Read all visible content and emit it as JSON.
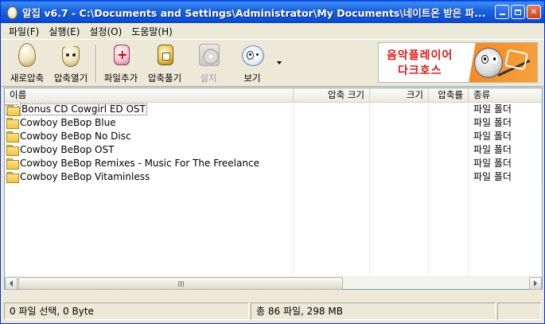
{
  "window": {
    "title": "알집 v6.7 - C:\\Documents and Settings\\Administrator\\My Documents\\네이트온 받은 파..."
  },
  "menu": [
    {
      "label": "파일(F)"
    },
    {
      "label": "실행(E)"
    },
    {
      "label": "설정(O)"
    },
    {
      "label": "도움말(H)"
    }
  ],
  "toolbar": {
    "new_archive": "새로압축",
    "open_archive": "압축열기",
    "add_files": "파일추가",
    "extract": "압축풀기",
    "install": "설치",
    "view": "보기"
  },
  "banner": {
    "line1": "음악플레이어",
    "line2": "다크호스"
  },
  "columns": {
    "name": "이름",
    "packed_size": "압축 크기",
    "size": "크기",
    "ratio": "압축률",
    "type": "종류"
  },
  "rows": [
    {
      "name": "Bonus CD Cowgirl ED OST",
      "packed_size": "",
      "size": "",
      "ratio": "",
      "type": "파일 폴더"
    },
    {
      "name": "Cowboy BeBop Blue",
      "packed_size": "",
      "size": "",
      "ratio": "",
      "type": "파일 폴더"
    },
    {
      "name": "Cowboy BeBop No Disc",
      "packed_size": "",
      "size": "",
      "ratio": "",
      "type": "파일 폴더"
    },
    {
      "name": "Cowboy BeBop OST",
      "packed_size": "",
      "size": "",
      "ratio": "",
      "type": "파일 폴더"
    },
    {
      "name": "Cowboy BeBop Remixes - Music For The Freelance",
      "packed_size": "",
      "size": "",
      "ratio": "",
      "type": "파일 폴더"
    },
    {
      "name": "Cowboy BeBop Vitaminless",
      "packed_size": "",
      "size": "",
      "ratio": "",
      "type": "파일 폴더"
    }
  ],
  "status": {
    "selection": "0 파일 선택, 0 Byte",
    "total": "총 86 파일, 298 MB",
    "extra": ""
  },
  "colors": {
    "titlebar": "#0b4fd0",
    "folder": "#f1c445",
    "banner_text": "#d81c1c"
  }
}
